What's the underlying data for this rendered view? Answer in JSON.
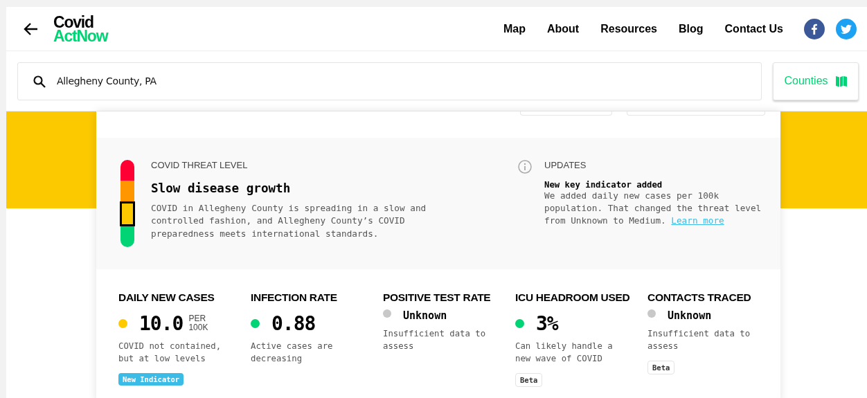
{
  "header": {
    "logo_top": "Covid",
    "logo_bottom": "ActNow",
    "nav": [
      "Map",
      "About",
      "Resources",
      "Blog",
      "Contact Us"
    ]
  },
  "search": {
    "value": "Allegheny County, PA",
    "map_button": "Counties"
  },
  "threat": {
    "heading": "COVID THREAT LEVEL",
    "title": "Slow disease growth",
    "description": "COVID in Allegheny County is spreading in a slow and controlled fashion, and Allegheny County’s COVID preparedness meets international standards.",
    "levels": [
      {
        "color": "#ff0034",
        "selected": false
      },
      {
        "color": "#ff9600",
        "selected": false
      },
      {
        "color": "#ffc900",
        "selected": true
      },
      {
        "color": "#00d474",
        "selected": false
      }
    ]
  },
  "updates": {
    "heading": "UPDATES",
    "title": "New key indicator added",
    "text": "We added daily new cases per 100k population. That changed the threat level from Unknown to Medium.",
    "link": "Learn more"
  },
  "metrics": [
    {
      "title": "DAILY NEW CASES",
      "color": "#ffc900",
      "kind": "number",
      "value": "10.0",
      "unit": "PER 100K",
      "description": "COVID not contained, but at low levels",
      "badge": {
        "label": "New Indicator",
        "kind": "new"
      }
    },
    {
      "title": "INFECTION RATE",
      "color": "#00d474",
      "kind": "number",
      "value": "0.88",
      "description": "Active cases are decreasing"
    },
    {
      "title": "POSITIVE TEST RATE",
      "color": "#c8c8c8",
      "kind": "unknown",
      "value": "Unknown",
      "description": "Insufficient data to assess"
    },
    {
      "title": "ICU HEADROOM USED",
      "color": "#00d474",
      "kind": "number",
      "value": "3%",
      "description": "Can likely handle a new wave of COVID",
      "badge": {
        "label": "Beta",
        "kind": "beta"
      }
    },
    {
      "title": "CONTACTS TRACED",
      "color": "#c8c8c8",
      "kind": "unknown",
      "value": "Unknown",
      "description": "Insufficient data to assess",
      "badge": {
        "label": "Beta",
        "kind": "beta"
      }
    }
  ]
}
